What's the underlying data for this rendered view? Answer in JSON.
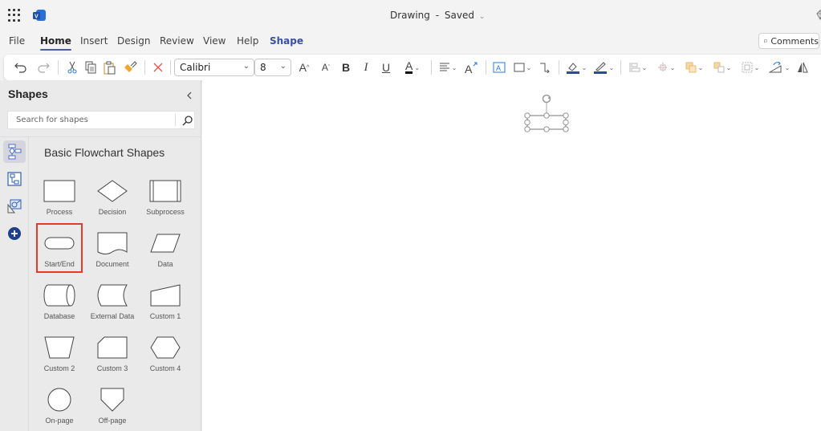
{
  "titlebar": {
    "app_launcher_icon": "waffle-grid-icon",
    "app_icon": "visio-logo-icon",
    "doc_name": "Drawing",
    "doc_separator": "-",
    "save_status": "Saved",
    "premium_icon": "diamond-icon"
  },
  "menu": {
    "tabs": [
      {
        "label": "File"
      },
      {
        "label": "Home",
        "active": true
      },
      {
        "label": "Insert"
      },
      {
        "label": "Design"
      },
      {
        "label": "Review"
      },
      {
        "label": "View"
      },
      {
        "label": "Help"
      },
      {
        "label": "Shape",
        "contextual": true
      }
    ],
    "comments_label": "Comments"
  },
  "ribbon": {
    "undo": "undo-icon",
    "redo": "redo-icon",
    "cut": "cut-icon",
    "copy": "copy-icon",
    "paste": "paste-icon",
    "format_painter": "format-painter-icon",
    "delete": "delete-icon",
    "font_name": "Calibri",
    "font_size": "8",
    "increase_font": "A",
    "decrease_font": "A",
    "bold": "B",
    "italic": "I",
    "underline": "U",
    "font_color": "A",
    "colors": {
      "accent": "#4a5ba8",
      "fill": "#2b4a9e",
      "delete": "#e05050",
      "highlight_box": "#e53a29"
    }
  },
  "sidebar": {
    "title": "Shapes",
    "search_placeholder": "Search for shapes",
    "rail": [
      {
        "icon": "flowchart-stencil-icon",
        "selected": true
      },
      {
        "icon": "org-stencil-icon"
      },
      {
        "icon": "more-stencils-icon"
      },
      {
        "icon": "add-stencil-icon"
      }
    ],
    "stencil_title": "Basic Flowchart Shapes",
    "shapes": [
      {
        "label": "Process",
        "kind": "process"
      },
      {
        "label": "Decision",
        "kind": "decision"
      },
      {
        "label": "Subprocess",
        "kind": "subprocess"
      },
      {
        "label": "Start/End",
        "kind": "startend",
        "highlighted": true
      },
      {
        "label": "Document",
        "kind": "document"
      },
      {
        "label": "Data",
        "kind": "data"
      },
      {
        "label": "Database",
        "kind": "database"
      },
      {
        "label": "External Data",
        "kind": "external"
      },
      {
        "label": "Custom 1",
        "kind": "custom1"
      },
      {
        "label": "Custom 2",
        "kind": "custom2"
      },
      {
        "label": "Custom 3",
        "kind": "custom3"
      },
      {
        "label": "Custom 4",
        "kind": "custom4"
      },
      {
        "label": "On-page",
        "kind": "onpage"
      },
      {
        "label": "Off-page",
        "kind": "offpage"
      }
    ]
  }
}
